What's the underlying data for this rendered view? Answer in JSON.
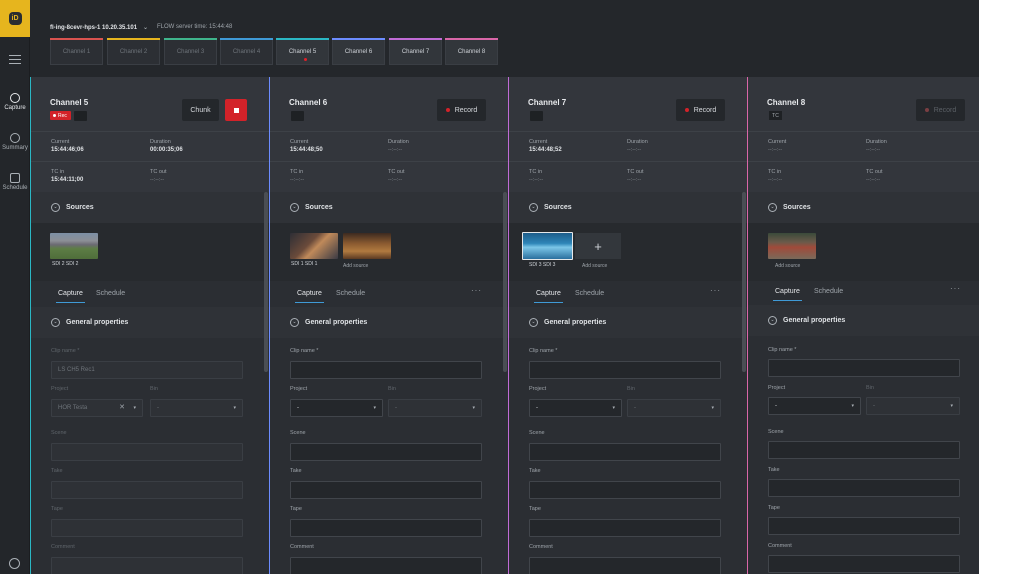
{
  "rail": {
    "logo": "iD",
    "nav": [
      {
        "label": "Capture",
        "icon": "capture-icon"
      },
      {
        "label": "Summary",
        "icon": "summary-icon"
      },
      {
        "label": "Schedule",
        "icon": "schedule-icon"
      }
    ]
  },
  "topbar": {
    "server": "fl-ing-8cevr-hps-1 10.20.35.101",
    "flow_time": "FLOW server time: 15:44:48",
    "tabs": [
      {
        "label": "Channel 1",
        "color": "#d9534f"
      },
      {
        "label": "Channel 2",
        "color": "#e6b51e"
      },
      {
        "label": "Channel 3",
        "color": "#3fb58c"
      },
      {
        "label": "Channel 4",
        "color": "#3f9ad6"
      },
      {
        "label": "Channel 5",
        "color": "#2bb7c4"
      },
      {
        "label": "Channel 6",
        "color": "#6c8cff"
      },
      {
        "label": "Channel 7",
        "color": "#c06bd6"
      },
      {
        "label": "Channel 8",
        "color": "#d966a8"
      }
    ]
  },
  "common": {
    "current": "Current",
    "duration": "Duration",
    "tc_in": "TC in",
    "tc_out": "TC out",
    "sources": "Sources",
    "capture_tab": "Capture",
    "schedule_tab": "Schedule",
    "general_properties": "General properties",
    "clip_name": "Clip name *",
    "project": "Project",
    "bin": "Bin",
    "scene": "Scene",
    "take": "Take",
    "tape": "Tape",
    "comment": "Comment",
    "add_source": "Add source",
    "dash": "--:--:--",
    "select_dash": "-",
    "more": "···",
    "record": "Record",
    "chunk": "Chunk",
    "rec": "Rec",
    "tc": "TC"
  },
  "channels": [
    {
      "title": "Channel 5",
      "current": "15:44:46;06",
      "duration": "00:00:35;06",
      "tc_in": "15:44:11;00",
      "tc_out": "--:--:--",
      "source": "SDI 2 SDI 2",
      "clip_name": "LS CH5 Rec1",
      "project": "HOR Testa",
      "edge": "#2bb7c4"
    },
    {
      "title": "Channel 6",
      "current": "15:44:48;50",
      "duration": "--:--:--",
      "tc_in": "--:--:--",
      "tc_out": "--:--:--",
      "source": "SDI 1 SDI 1",
      "edge": "#6c8cff"
    },
    {
      "title": "Channel 7",
      "current": "15:44:48;52",
      "duration": "--:--:--",
      "tc_in": "--:--:--",
      "tc_out": "--:--:--",
      "source": "SDI 3 SDI 3",
      "edge": "#c06bd6"
    },
    {
      "title": "Channel 8",
      "current": "--:--:--",
      "duration": "--:--:--",
      "tc_in": "--:--:--",
      "tc_out": "--:--:--",
      "edge": "#d966a8"
    }
  ]
}
